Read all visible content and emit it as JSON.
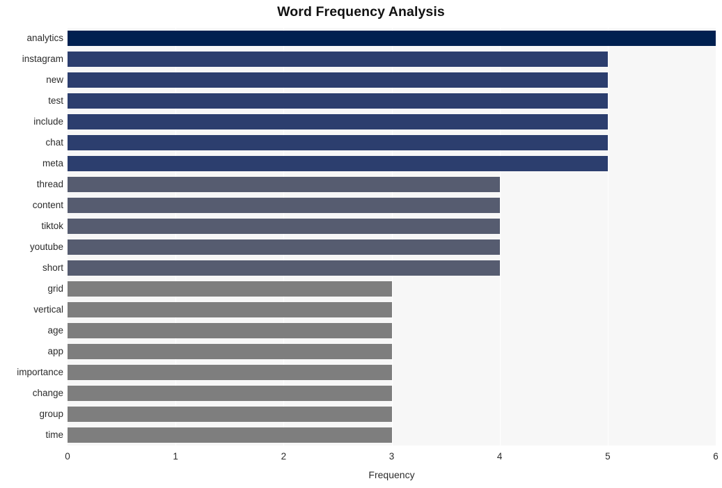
{
  "chart_data": {
    "type": "bar",
    "orientation": "horizontal",
    "title": "Word Frequency Analysis",
    "xlabel": "Frequency",
    "ylabel": "",
    "xlim": [
      0,
      6
    ],
    "xticks": [
      0,
      1,
      2,
      3,
      4,
      5,
      6
    ],
    "xtick_labels": [
      "0",
      "1",
      "2",
      "3",
      "4",
      "5",
      "6"
    ],
    "grid": true,
    "grid_axis": "x",
    "legend": false,
    "categories": [
      "analytics",
      "instagram",
      "new",
      "test",
      "include",
      "chat",
      "meta",
      "thread",
      "content",
      "tiktok",
      "youtube",
      "short",
      "grid",
      "vertical",
      "age",
      "app",
      "importance",
      "change",
      "group",
      "time"
    ],
    "values": [
      6,
      5,
      5,
      5,
      5,
      5,
      5,
      4,
      4,
      4,
      4,
      4,
      3,
      3,
      3,
      3,
      3,
      3,
      3,
      3
    ],
    "bar_colors": [
      "#002050",
      "#2c3e6e",
      "#2c3e6e",
      "#2c3e6e",
      "#2c3e6e",
      "#2c3e6e",
      "#2c3e6e",
      "#565c70",
      "#565c70",
      "#565c70",
      "#565c70",
      "#565c70",
      "#7e7e7e",
      "#7e7e7e",
      "#7e7e7e",
      "#7e7e7e",
      "#7e7e7e",
      "#7e7e7e",
      "#7e7e7e",
      "#7e7e7e"
    ],
    "plot_background": "#f7f7f7",
    "figure_background": "#ffffff",
    "gridline_color": "#ffffff"
  }
}
